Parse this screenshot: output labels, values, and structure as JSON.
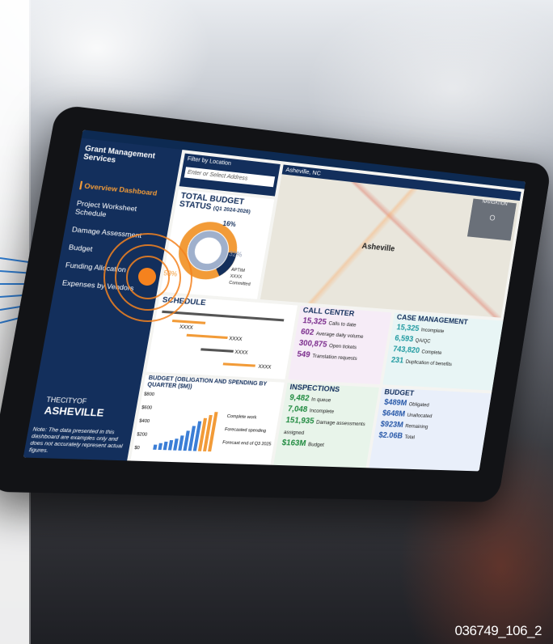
{
  "dashboard": {
    "title": "Grant Management Services",
    "nav": [
      "Overview Dashboard",
      "Project Worksheet Schedule",
      "Damage Assessment",
      "Budget",
      "Funding Allocation",
      "Expenses by Vendors"
    ],
    "filter_label": "Filter by Location",
    "filter_placeholder": "Enter or Select Address",
    "map_location": "Asheville, NC",
    "map_city": "Asheville",
    "navigation_label": "NAVIGATION",
    "city_logo_top": "THECITYOF",
    "city_logo_bottom": "ASHEVILLE",
    "note": "Note: The data presented in this dashboard are examples only and does not accurately represent actual figures."
  },
  "budget_status": {
    "title": "TOTAL BUDGET STATUS",
    "period": "(Q1 2024-2026)",
    "pct_top": "16%",
    "pct_mid": "32%",
    "pct_left": "53%",
    "legend": [
      "APTIM",
      "XXXX",
      "Committed"
    ]
  },
  "schedule": {
    "title": "SCHEDULE",
    "labels": [
      "XXXX",
      "XXXX",
      "XXXX",
      "XXXX"
    ]
  },
  "call_center": {
    "title": "CALL CENTER",
    "metrics": [
      {
        "value": "15,325",
        "label": "Calls to date"
      },
      {
        "value": "602",
        "label": "Average daily volume"
      },
      {
        "value": "300,875",
        "label": "Open tickets"
      },
      {
        "value": "549",
        "label": "Translation requests"
      }
    ]
  },
  "case_management": {
    "title": "CASE MANAGEMENT",
    "metrics": [
      {
        "value": "15,325",
        "label": "Incomplete"
      },
      {
        "value": "6,593",
        "label": "QA/QC"
      },
      {
        "value": "743,820",
        "label": "Complete"
      },
      {
        "value": "231",
        "label": "Duplication of benefits"
      }
    ]
  },
  "inspections": {
    "title": "INSPECTIONS",
    "metrics": [
      {
        "value": "9,482",
        "label": "In queue"
      },
      {
        "value": "7,048",
        "label": "Incomplete"
      },
      {
        "value": "151,935",
        "label": "Damage assessments assigned"
      },
      {
        "value": "$163M",
        "label": "Budget"
      }
    ]
  },
  "budget": {
    "title": "BUDGET",
    "metrics": [
      {
        "value": "$489M",
        "label": "Obligated"
      },
      {
        "value": "$648M",
        "label": "Unallocated"
      },
      {
        "value": "$923M",
        "label": "Remaining"
      },
      {
        "value": "$2.06B",
        "label": "Total"
      }
    ]
  },
  "spending": {
    "title": "BUDGET (OBLIGATION AND SPENDING BY QUARTER ($M))",
    "yticks": [
      "$800",
      "$600",
      "$400",
      "$200",
      "$0"
    ],
    "legend": [
      "Complete work",
      "Forecasted spending",
      "Forecast end of Q3 2025"
    ]
  },
  "photo_id": "036749_106_2",
  "colors": {
    "navy": "#132f5c",
    "orange": "#f29b38",
    "teal": "#1f9aa0",
    "purple": "#7a2b8c",
    "green": "#1f8a3f"
  }
}
